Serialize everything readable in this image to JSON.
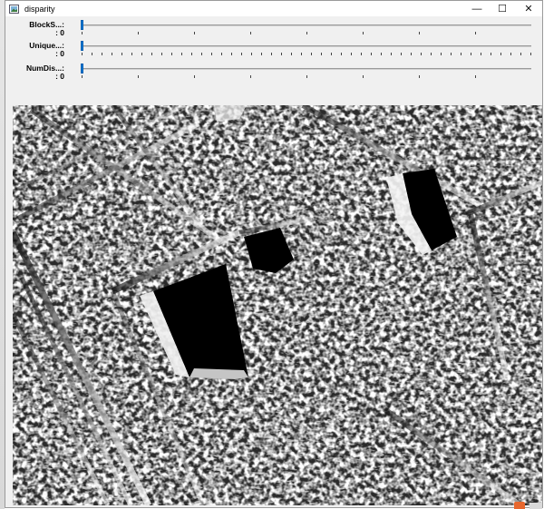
{
  "window": {
    "title": "disparity",
    "app_icon": "image-window-icon",
    "controls": {
      "minimize_icon": "minimize-icon",
      "maximize_icon": "maximize-icon",
      "close_icon": "close-icon",
      "minimize": "—",
      "maximize": "☐",
      "close": "✕"
    }
  },
  "trackbars": [
    {
      "name": "BlockS...:",
      "value": ": 0",
      "position": 0,
      "tick_style": "major"
    },
    {
      "name": "Unique...:",
      "value": ": 0",
      "position": 0,
      "tick_style": "minor"
    },
    {
      "name": "NumDis...:",
      "value": ": 0",
      "position": 0,
      "tick_style": "major"
    }
  ],
  "display": {
    "content": "disparity-map-image",
    "colors": {
      "background": "#000000",
      "foreground": "#ffffff"
    }
  }
}
